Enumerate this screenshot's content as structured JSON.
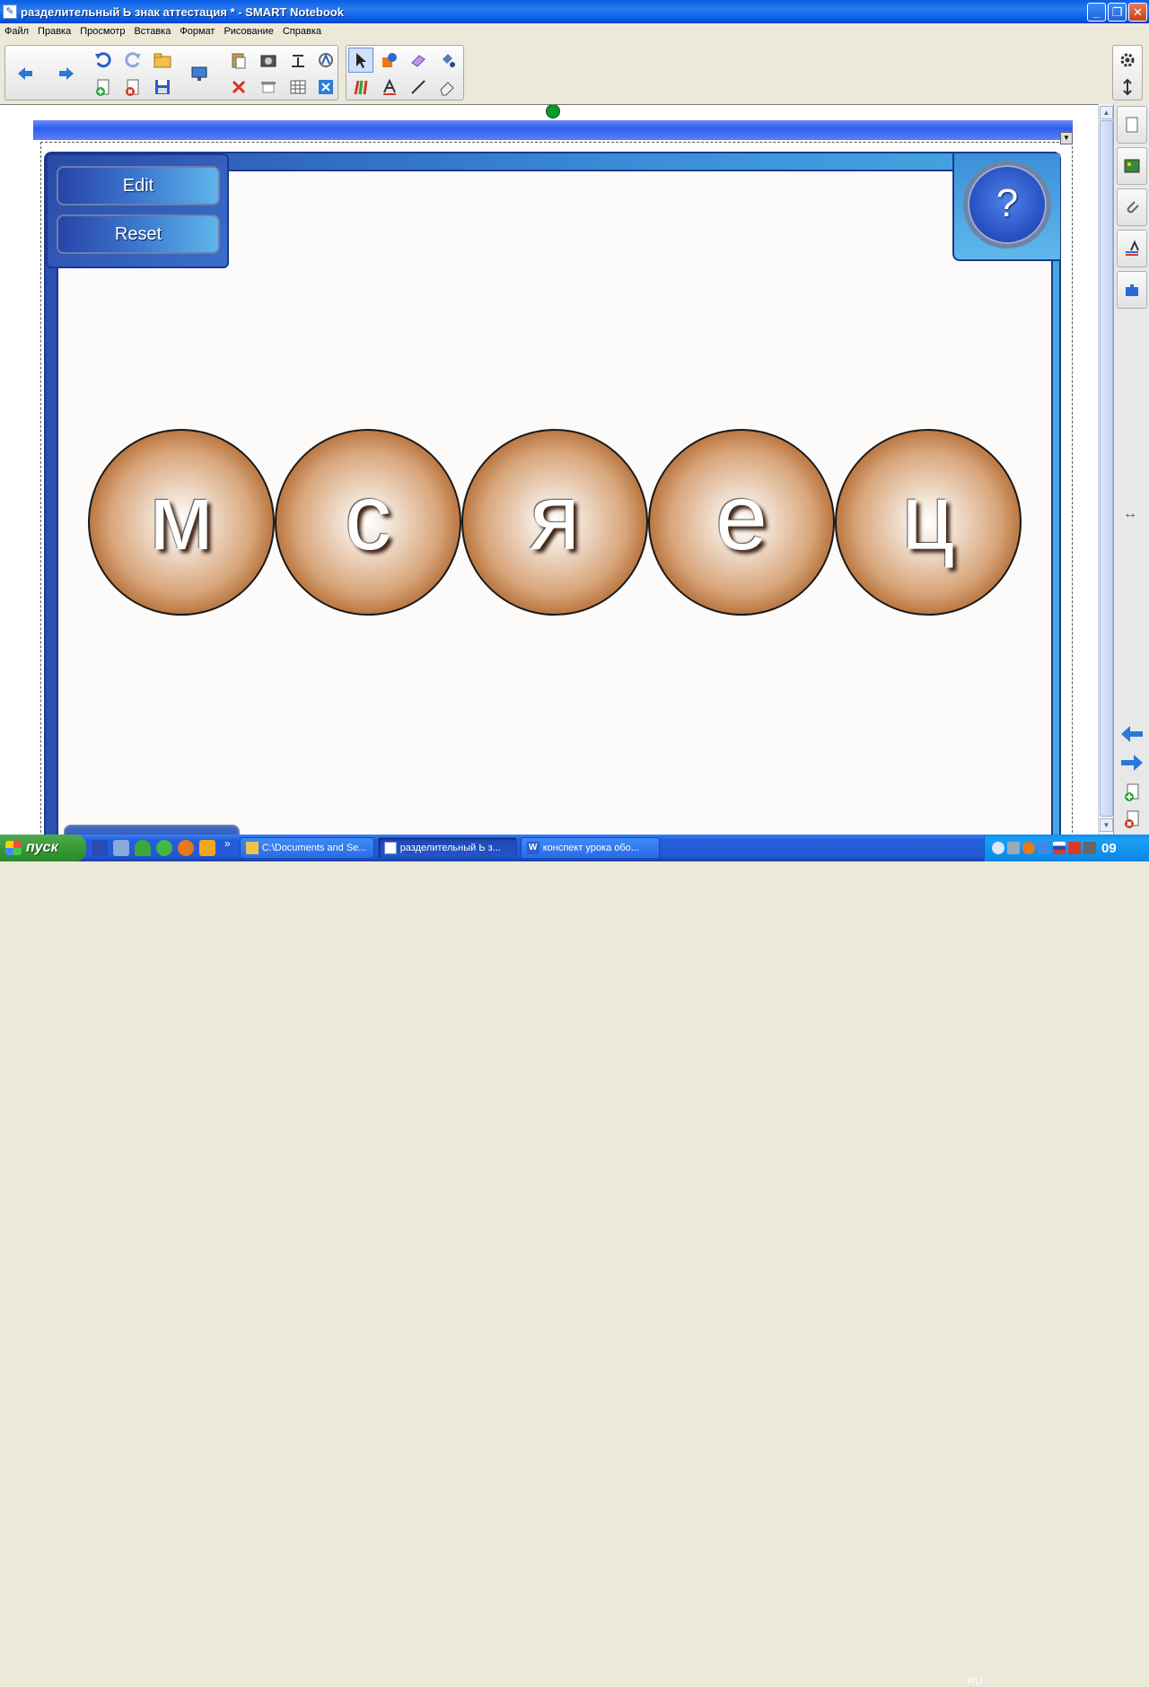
{
  "window": {
    "title": "разделительный Ь знак аттестация * - SMART Notebook"
  },
  "menu": [
    "Файл",
    "Правка",
    "Просмотр",
    "Вставка",
    "Формат",
    "Рисование",
    "Справка"
  ],
  "activity": {
    "edit_label": "Edit",
    "reset_label": "Reset",
    "help_label": "?",
    "letters": [
      "м",
      "с",
      "я",
      "е",
      "ц"
    ]
  },
  "taskbar": {
    "start_label": "пуск",
    "more": "»",
    "tasks": [
      {
        "label": "C:\\Documents and Se..."
      },
      {
        "label": "разделительный Ь з..."
      },
      {
        "label": "конспект урока обо..."
      }
    ],
    "lang": "RU",
    "clock": "09"
  },
  "colors": {
    "accent": "#2f5ef0",
    "tile": "#a95d22",
    "frame": "#1c3a8c"
  }
}
